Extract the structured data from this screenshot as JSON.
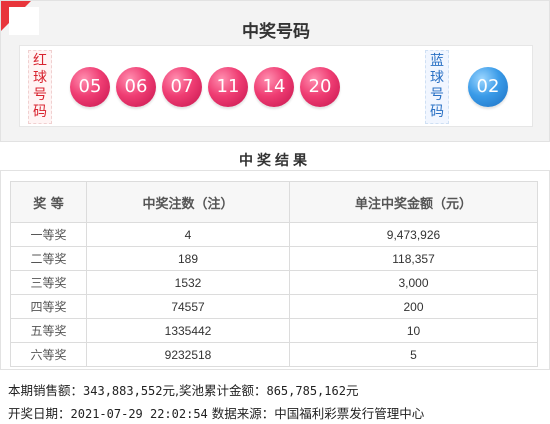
{
  "header": {
    "title": "中奖号码",
    "red_label": [
      "红",
      "球",
      "号",
      "码"
    ],
    "blue_label": [
      "蓝",
      "球",
      "号",
      "码"
    ],
    "red_balls": [
      "05",
      "06",
      "07",
      "11",
      "14",
      "20"
    ],
    "blue_ball": "02",
    "colors": {
      "red_ball": "#ef3d73",
      "blue_ball": "#3a9be8",
      "corner": "#e8353b"
    }
  },
  "results": {
    "title": "中奖结果",
    "columns": [
      "奖 等",
      "中奖注数（注）",
      "单注中奖金额（元）"
    ],
    "rows": [
      {
        "level": "一等奖",
        "count": "4",
        "amount": "9,473,926"
      },
      {
        "level": "二等奖",
        "count": "189",
        "amount": "118,357"
      },
      {
        "level": "三等奖",
        "count": "1532",
        "amount": "3,000"
      },
      {
        "level": "四等奖",
        "count": "74557",
        "amount": "200"
      },
      {
        "level": "五等奖",
        "count": "1335442",
        "amount": "10"
      },
      {
        "level": "六等奖",
        "count": "9232518",
        "amount": "5"
      }
    ]
  },
  "footer": {
    "sales_label": "本期销售额：",
    "sales_value": "343,883,552",
    "sales_unit_and_pool_label": "元,奖池累计金额：",
    "pool_value": "865,785,162",
    "pool_unit": "元",
    "date_label": "开奖日期：",
    "date_value": "2021-07-29 22:02:54",
    "source_label": "数据来源：",
    "source_value": "中国福利彩票发行管理中心"
  }
}
